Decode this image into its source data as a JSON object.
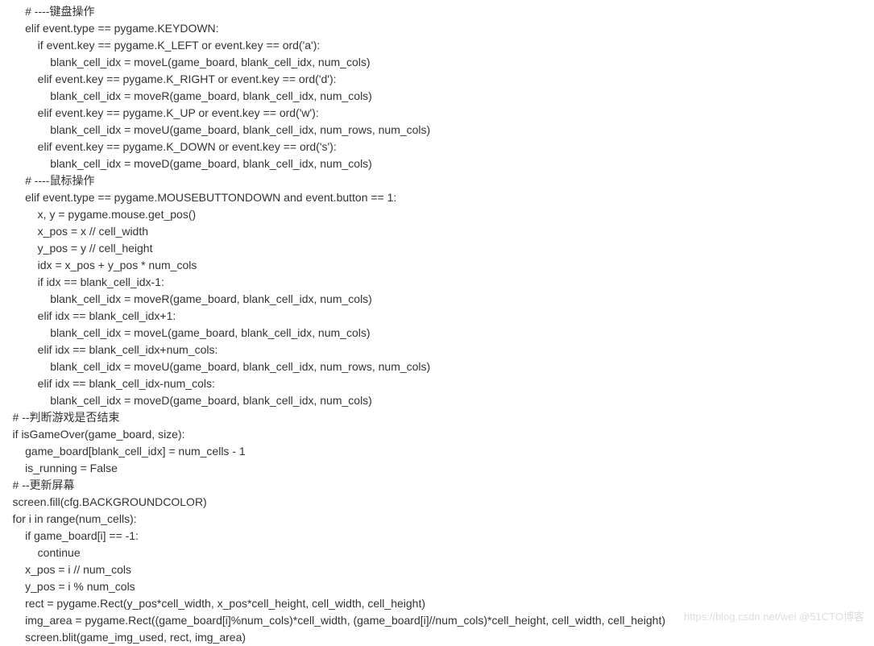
{
  "code": {
    "lines": [
      "        # ----键盘操作",
      "        elif event.type == pygame.KEYDOWN:",
      "            if event.key == pygame.K_LEFT or event.key == ord('a'):",
      "                blank_cell_idx = moveL(game_board, blank_cell_idx, num_cols)",
      "            elif event.key == pygame.K_RIGHT or event.key == ord('d'):",
      "                blank_cell_idx = moveR(game_board, blank_cell_idx, num_cols)",
      "            elif event.key == pygame.K_UP or event.key == ord('w'):",
      "                blank_cell_idx = moveU(game_board, blank_cell_idx, num_rows, num_cols)",
      "            elif event.key == pygame.K_DOWN or event.key == ord('s'):",
      "                blank_cell_idx = moveD(game_board, blank_cell_idx, num_cols)",
      "        # ----鼠标操作",
      "        elif event.type == pygame.MOUSEBUTTONDOWN and event.button == 1:",
      "            x, y = pygame.mouse.get_pos()",
      "            x_pos = x // cell_width",
      "            y_pos = y // cell_height",
      "            idx = x_pos + y_pos * num_cols",
      "            if idx == blank_cell_idx-1:",
      "                blank_cell_idx = moveR(game_board, blank_cell_idx, num_cols)",
      "            elif idx == blank_cell_idx+1:",
      "                blank_cell_idx = moveL(game_board, blank_cell_idx, num_cols)",
      "            elif idx == blank_cell_idx+num_cols:",
      "                blank_cell_idx = moveU(game_board, blank_cell_idx, num_rows, num_cols)",
      "            elif idx == blank_cell_idx-num_cols:",
      "                blank_cell_idx = moveD(game_board, blank_cell_idx, num_cols)",
      "    # --判断游戏是否结束",
      "    if isGameOver(game_board, size):",
      "        game_board[blank_cell_idx] = num_cells - 1",
      "        is_running = False",
      "    # --更新屏幕",
      "    screen.fill(cfg.BACKGROUNDCOLOR)",
      "    for i in range(num_cells):",
      "        if game_board[i] == -1:",
      "            continue",
      "        x_pos = i // num_cols",
      "        y_pos = i % num_cols",
      "        rect = pygame.Rect(y_pos*cell_width, x_pos*cell_height, cell_width, cell_height)",
      "        img_area = pygame.Rect((game_board[i]%num_cols)*cell_width, (game_board[i]//num_cols)*cell_height, cell_width, cell_height)",
      "        screen.blit(game_img_used, rect, img_area)"
    ]
  },
  "watermark": "https://blog.csdn.net/wei @51CTO博客"
}
